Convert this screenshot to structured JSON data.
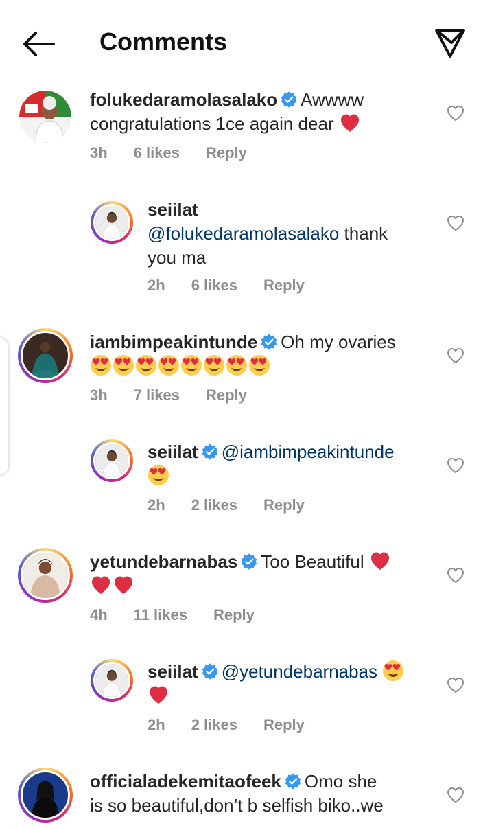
{
  "header": {
    "title": "Comments"
  },
  "comments": [
    {
      "username": "folukedaramolasalako",
      "text": "Awwww congratulations 1ce again dear",
      "time": "3h",
      "likes": "6 likes",
      "reply": "Reply",
      "line1": "Awwww",
      "line2": "congratulations 1ce again dear"
    },
    {
      "username": "seiilat",
      "mention": "@folukedaramolasalako",
      "text_after": " thank",
      "line2": "you ma",
      "time": "2h",
      "likes": "6 likes",
      "reply": "Reply"
    },
    {
      "username": "iambimpeakintunde",
      "text": "Oh my ovaries",
      "time": "3h",
      "likes": "7 likes",
      "reply": "Reply"
    },
    {
      "username": "seiilat",
      "mention": "@iambimpeakintunde",
      "time": "2h",
      "likes": "2 likes",
      "reply": "Reply"
    },
    {
      "username": "yetundebarnabas",
      "text": "Too Beautiful",
      "time": "4h",
      "likes": "11 likes",
      "reply": "Reply"
    },
    {
      "username": "seiilat",
      "mention": "@yetundebarnabas",
      "time": "2h",
      "likes": "2 likes",
      "reply": "Reply"
    },
    {
      "username": "officialadekemitaofeek",
      "line1": "Omo she",
      "line2": "is so beautiful,don’t b selfish biko..we"
    }
  ],
  "colors": {
    "mention": "#00376b",
    "heart": "#e0245e",
    "verified": "#3897f0"
  },
  "icons": [
    "back-arrow-icon",
    "send-icon",
    "verified-icon",
    "heart-outline-icon",
    "red-heart-emoji",
    "heart-eyes-emoji"
  ]
}
